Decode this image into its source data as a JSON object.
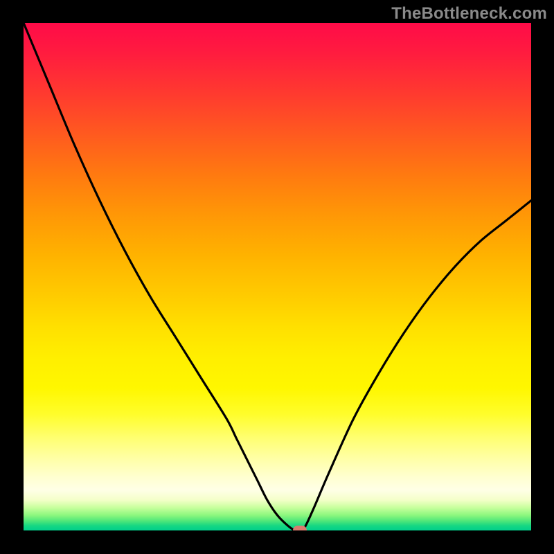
{
  "watermark": "TheBottleneck.com",
  "chart_data": {
    "type": "line",
    "title": "",
    "xlabel": "",
    "ylabel": "",
    "xlim": [
      0,
      100
    ],
    "ylim": [
      0,
      100
    ],
    "series": [
      {
        "name": "bottleneck-curve",
        "x": [
          0,
          5,
          10,
          15,
          20,
          25,
          30,
          35,
          40,
          42,
          44,
          46,
          48,
          50,
          52,
          53.5,
          55,
          57,
          60,
          65,
          70,
          75,
          80,
          85,
          90,
          95,
          100
        ],
        "values": [
          100,
          88,
          76,
          65,
          55,
          46,
          38,
          30,
          22,
          18,
          14,
          10,
          6,
          3,
          1,
          0,
          0,
          4,
          11,
          22,
          31,
          39,
          46,
          52,
          57,
          61,
          65
        ]
      }
    ],
    "marker": {
      "x": 54.5,
      "y": 0,
      "color": "#d87b6f"
    },
    "background_gradient": {
      "top": "#ff0b48",
      "mid": "#ffe000",
      "bottom": "#00cf8b"
    }
  }
}
